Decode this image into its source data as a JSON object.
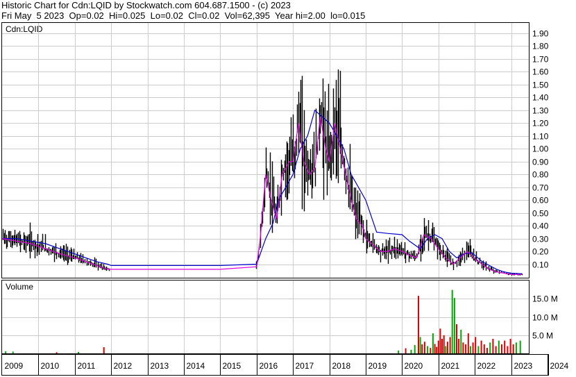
{
  "header": {
    "line1": "Historic Chart for Cdn:LQID by Stockwatch.com 604.687.1500 - (c) 2023",
    "line2": "Fri May  5 2023  Op=0.02  Hi=0.025  Lo=0.02  Cl=0.02  Vol=62,395  Year hi=2.00  lo=0.015"
  },
  "chart_data": [
    {
      "type": "ohlc-price",
      "symbol_label": "Cdn:LQID",
      "ylim": [
        0,
        2.0
      ],
      "y_ticks": [
        "1.90",
        "1.80",
        "1.70",
        "1.60",
        "1.50",
        "1.40",
        "1.30",
        "1.20",
        "1.10",
        "1.00",
        "0.90",
        "0.80",
        "0.70",
        "0.60",
        "0.50",
        "0.40",
        "0.30",
        "0.20",
        "0.10"
      ],
      "x_ticks": [
        "2009",
        "2010",
        "2011",
        "2012",
        "2013",
        "2014",
        "2015",
        "2016",
        "2017",
        "2018",
        "2019",
        "2020",
        "2021",
        "2022",
        "2023",
        "2024"
      ],
      "grid": true,
      "bar_color": "#000000",
      "series": [
        {
          "name": "",
          "color": "#0000cc",
          "x": [
            2009.0,
            2009.4,
            2009.8,
            2010.2,
            2010.6,
            2011.0,
            2011.3,
            2011.6,
            2011.9,
            2012.0,
            2013.0,
            2014.0,
            2015.0,
            2016.0,
            2016.25,
            2016.45,
            2016.6,
            2016.8,
            2017.0,
            2017.2,
            2017.4,
            2017.6,
            2017.8,
            2018.0,
            2018.2,
            2018.4,
            2018.6,
            2018.8,
            2019.0,
            2019.3,
            2019.6,
            2020.0,
            2020.2,
            2020.5,
            2020.7,
            2020.9,
            2021.1,
            2021.3,
            2021.5,
            2021.7,
            2021.9,
            2022.0,
            2022.2,
            2022.4,
            2022.6,
            2022.8,
            2023.0,
            2023.3
          ],
          "y": [
            0.3,
            0.3,
            0.28,
            0.26,
            0.22,
            0.18,
            0.15,
            0.12,
            0.1,
            0.09,
            0.09,
            0.09,
            0.09,
            0.1,
            0.3,
            0.42,
            0.6,
            0.7,
            0.8,
            1.0,
            1.1,
            1.3,
            1.25,
            1.2,
            1.1,
            1.0,
            0.8,
            0.7,
            0.6,
            0.35,
            0.34,
            0.33,
            0.28,
            0.22,
            0.3,
            0.33,
            0.3,
            0.2,
            0.15,
            0.18,
            0.19,
            0.17,
            0.12,
            0.09,
            0.06,
            0.04,
            0.03,
            0.025
          ]
        },
        {
          "name": "",
          "color": "#dd00dd",
          "x": [
            2009.0,
            2009.4,
            2009.8,
            2010.2,
            2010.6,
            2011.0,
            2011.3,
            2011.6,
            2011.9,
            2012.0,
            2013.0,
            2014.0,
            2015.0,
            2016.0,
            2016.1,
            2016.25,
            2016.4,
            2016.55,
            2016.7,
            2016.9,
            2017.0,
            2017.15,
            2017.3,
            2017.45,
            2017.6,
            2017.75,
            2017.9,
            2018.0,
            2018.15,
            2018.3,
            2018.45,
            2018.6,
            2018.75,
            2018.9,
            2019.0,
            2019.2,
            2019.4,
            2019.6,
            2019.8,
            2020.0,
            2020.2,
            2020.4,
            2020.6,
            2020.8,
            2021.0,
            2021.2,
            2021.4,
            2021.6,
            2021.8,
            2022.0,
            2022.2,
            2022.4,
            2022.6,
            2022.8,
            2023.0,
            2023.3
          ],
          "y": [
            0.3,
            0.28,
            0.26,
            0.22,
            0.18,
            0.15,
            0.12,
            0.09,
            0.06,
            0.06,
            0.06,
            0.06,
            0.06,
            0.08,
            0.3,
            0.8,
            0.6,
            0.45,
            0.8,
            0.9,
            0.9,
            1.2,
            0.9,
            0.8,
            0.85,
            1.25,
            1.0,
            0.9,
            1.2,
            1.0,
            0.8,
            0.6,
            0.45,
            0.4,
            0.3,
            0.25,
            0.2,
            0.2,
            0.22,
            0.2,
            0.17,
            0.15,
            0.33,
            0.3,
            0.22,
            0.15,
            0.1,
            0.15,
            0.2,
            0.14,
            0.1,
            0.06,
            0.04,
            0.03,
            0.02,
            0.02
          ]
        }
      ]
    },
    {
      "type": "bar",
      "title": "Volume",
      "y_ticks": [
        "15.0 M",
        "10.0 M",
        "5.0 M"
      ],
      "ylim": [
        0,
        20
      ],
      "unit": "M",
      "colors": {
        "up": "#00aa00",
        "down": "#dd0000"
      },
      "bars": [
        {
          "x": 2009.1,
          "v": 0.6,
          "c": "up"
        },
        {
          "x": 2009.3,
          "v": 0.5,
          "c": "up"
        },
        {
          "x": 2010.5,
          "v": 0.3,
          "c": "down"
        },
        {
          "x": 2011.1,
          "v": 0.4,
          "c": "up"
        },
        {
          "x": 2011.8,
          "v": 1.7,
          "c": "down"
        },
        {
          "x": 2019.9,
          "v": 0.8,
          "c": "up"
        },
        {
          "x": 2020.1,
          "v": 1.4,
          "c": "down"
        },
        {
          "x": 2020.25,
          "v": 1.0,
          "c": "up"
        },
        {
          "x": 2020.35,
          "v": 2.3,
          "c": "up"
        },
        {
          "x": 2020.45,
          "v": 15.8,
          "c": "down"
        },
        {
          "x": 2020.5,
          "v": 4.5,
          "c": "up"
        },
        {
          "x": 2020.55,
          "v": 2.5,
          "c": "down"
        },
        {
          "x": 2020.62,
          "v": 3.2,
          "c": "down"
        },
        {
          "x": 2020.7,
          "v": 2.0,
          "c": "up"
        },
        {
          "x": 2020.78,
          "v": 1.5,
          "c": "down"
        },
        {
          "x": 2020.85,
          "v": 5.5,
          "c": "up"
        },
        {
          "x": 2020.9,
          "v": 2.6,
          "c": "down"
        },
        {
          "x": 2020.95,
          "v": 1.8,
          "c": "down"
        },
        {
          "x": 2021.0,
          "v": 3.5,
          "c": "down"
        },
        {
          "x": 2021.05,
          "v": 6.8,
          "c": "down"
        },
        {
          "x": 2021.1,
          "v": 4.0,
          "c": "down"
        },
        {
          "x": 2021.15,
          "v": 5.0,
          "c": "down"
        },
        {
          "x": 2021.2,
          "v": 2.0,
          "c": "up"
        },
        {
          "x": 2021.25,
          "v": 3.2,
          "c": "down"
        },
        {
          "x": 2021.32,
          "v": 4.5,
          "c": "down"
        },
        {
          "x": 2021.38,
          "v": 17.4,
          "c": "up"
        },
        {
          "x": 2021.44,
          "v": 15.2,
          "c": "up"
        },
        {
          "x": 2021.5,
          "v": 8.0,
          "c": "down"
        },
        {
          "x": 2021.56,
          "v": 4.0,
          "c": "down"
        },
        {
          "x": 2021.62,
          "v": 6.5,
          "c": "up"
        },
        {
          "x": 2021.68,
          "v": 3.0,
          "c": "down"
        },
        {
          "x": 2021.75,
          "v": 2.5,
          "c": "down"
        },
        {
          "x": 2021.82,
          "v": 5.5,
          "c": "down"
        },
        {
          "x": 2021.88,
          "v": 2.0,
          "c": "up"
        },
        {
          "x": 2021.95,
          "v": 3.0,
          "c": "down"
        },
        {
          "x": 2022.02,
          "v": 4.5,
          "c": "down"
        },
        {
          "x": 2022.1,
          "v": 2.0,
          "c": "up"
        },
        {
          "x": 2022.18,
          "v": 3.5,
          "c": "down"
        },
        {
          "x": 2022.26,
          "v": 2.5,
          "c": "down"
        },
        {
          "x": 2022.34,
          "v": 1.5,
          "c": "down"
        },
        {
          "x": 2022.42,
          "v": 3.0,
          "c": "up"
        },
        {
          "x": 2022.5,
          "v": 4.0,
          "c": "down"
        },
        {
          "x": 2022.58,
          "v": 2.0,
          "c": "down"
        },
        {
          "x": 2022.66,
          "v": 3.5,
          "c": "up"
        },
        {
          "x": 2022.74,
          "v": 2.5,
          "c": "down"
        },
        {
          "x": 2022.82,
          "v": 3.5,
          "c": "down"
        },
        {
          "x": 2022.9,
          "v": 2.0,
          "c": "down"
        },
        {
          "x": 2022.98,
          "v": 4.0,
          "c": "down"
        },
        {
          "x": 2023.06,
          "v": 2.5,
          "c": "down"
        },
        {
          "x": 2023.14,
          "v": 3.0,
          "c": "up"
        },
        {
          "x": 2023.25,
          "v": 3.5,
          "c": "up"
        }
      ]
    }
  ]
}
